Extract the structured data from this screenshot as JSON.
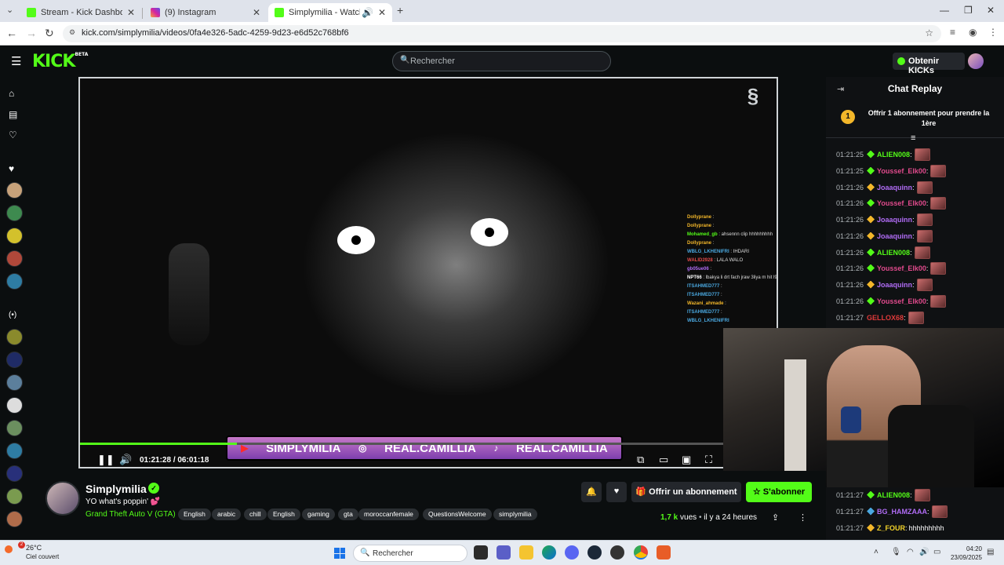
{
  "browser": {
    "tabs": [
      {
        "title": "Stream - Kick Dashboard",
        "active": false
      },
      {
        "title": "(9) Instagram",
        "active": false
      },
      {
        "title": "Simplymilia - Watch the VO",
        "active": true
      }
    ],
    "url": "kick.com/simplymilia/videos/0fa4e326-5adc-4259-9d23-e6d52c768bf6"
  },
  "kick": {
    "logo": "KICK",
    "logo_beta": "BETA",
    "search_placeholder": "Rechercher",
    "kicks_button": "Obtenir KICKs"
  },
  "player": {
    "time_current": "01:21:28",
    "time_separator": "/",
    "time_total": "06:01:18",
    "progress_fraction": 0.225,
    "overlay_handles": [
      "SIMPLYMILIA",
      "REAL.CAMILLIA",
      "REAL.CAMILLIA"
    ],
    "video_chat": [
      {
        "user": "Dollyprane",
        "text": ":"
      },
      {
        "user": "Dollyprane",
        "text": ":"
      },
      {
        "user": "Mohamed_gb",
        "text": ": ahsennn clip hhhhhhhhh"
      },
      {
        "user": "Dollyprane",
        "text": ":"
      },
      {
        "user": "WBLG_LKHENIFRI",
        "text": ": IHDARI"
      },
      {
        "user": "WALID2928",
        "text": ": LALA WALO"
      },
      {
        "user": "gb05ue06",
        "text": ":"
      },
      {
        "user": "NPT66",
        "text": ": lbakya li drt fach jraw 3liya m hit l9awni kndy3 lw9t fi twalit"
      },
      {
        "user": "ITSAHMED777",
        "text": ":"
      },
      {
        "user": "ITSAHMED777",
        "text": ":"
      },
      {
        "user": "Wazani_ahmade",
        "text": ":"
      },
      {
        "user": "ITSAHMED777",
        "text": ":"
      },
      {
        "user": "WBLG_LKHENIFRI",
        "text": ""
      }
    ]
  },
  "chat": {
    "title": "Chat Replay",
    "gift_count": "1",
    "gift_text": "Offrir 1 abonnement pour prendre la 1ère",
    "messages": [
      {
        "time": "01:21:25",
        "user": "ALIEN008",
        "color": "#53fc18",
        "badge": "#53fc18",
        "text": ""
      },
      {
        "time": "01:21:25",
        "user": "Youssef_Elk00",
        "color": "#e04a8c",
        "badge": "#53fc18",
        "text": ""
      },
      {
        "time": "01:21:26",
        "user": "Joaaquinn",
        "color": "#b06cf5",
        "badge": "#f3b72a",
        "text": ""
      },
      {
        "time": "01:21:26",
        "user": "Youssef_Elk00",
        "color": "#e04a8c",
        "badge": "#53fc18",
        "text": ""
      },
      {
        "time": "01:21:26",
        "user": "Joaaquinn",
        "color": "#b06cf5",
        "badge": "#f3b72a",
        "text": ""
      },
      {
        "time": "01:21:26",
        "user": "Joaaquinn",
        "color": "#b06cf5",
        "badge": "#f3b72a",
        "text": ""
      },
      {
        "time": "01:21:26",
        "user": "ALIEN008",
        "color": "#53fc18",
        "badge": "#53fc18",
        "text": ""
      },
      {
        "time": "01:21:26",
        "user": "Youssef_Elk00",
        "color": "#e04a8c",
        "badge": "#53fc18",
        "text": ""
      },
      {
        "time": "01:21:26",
        "user": "Joaaquinn",
        "color": "#b06cf5",
        "badge": "#f3b72a",
        "text": ""
      },
      {
        "time": "01:21:26",
        "user": "Youssef_Elk00",
        "color": "#e04a8c",
        "badge": "#53fc18",
        "text": ""
      },
      {
        "time": "01:21:27",
        "user": "GELLOX68",
        "color": "#e03a3a",
        "badge": "",
        "text": ""
      },
      {
        "time": "01:21:27",
        "user": "ALIEN008",
        "color": "#53fc18",
        "badge": "#53fc18",
        "text": ""
      },
      {
        "time": "01:21:27",
        "user": "BG_HAMZAAA",
        "color": "#b06cf5",
        "badge": "#4aa8e0",
        "text": ""
      },
      {
        "time": "01:21:27",
        "user": "Z_FOUR",
        "color": "#f3d42a",
        "badge": "#f3b72a",
        "text": "hhhhhhhhh"
      }
    ]
  },
  "stream": {
    "name": "Simplymilia",
    "title": "YO what's poppin' 💕",
    "category": "Grand Theft Auto V (GTA)",
    "tags": [
      "English",
      "arabic",
      "chill",
      "English",
      "gaming",
      "gta",
      "moroccanfemale",
      "QuestionsWelcome",
      "simplymilia"
    ],
    "gift_button": "Offrir un abonnement",
    "subscribe_button": "S'abonner",
    "views": "1,7 k",
    "views_label": "vues",
    "ago": "il y a 24 heures"
  },
  "taskbar": {
    "temperature": "26°C",
    "weather": "Ciel couvert",
    "search": "Rechercher",
    "time": "04:20",
    "date": "23/09/2025",
    "weather_badge": "2"
  }
}
